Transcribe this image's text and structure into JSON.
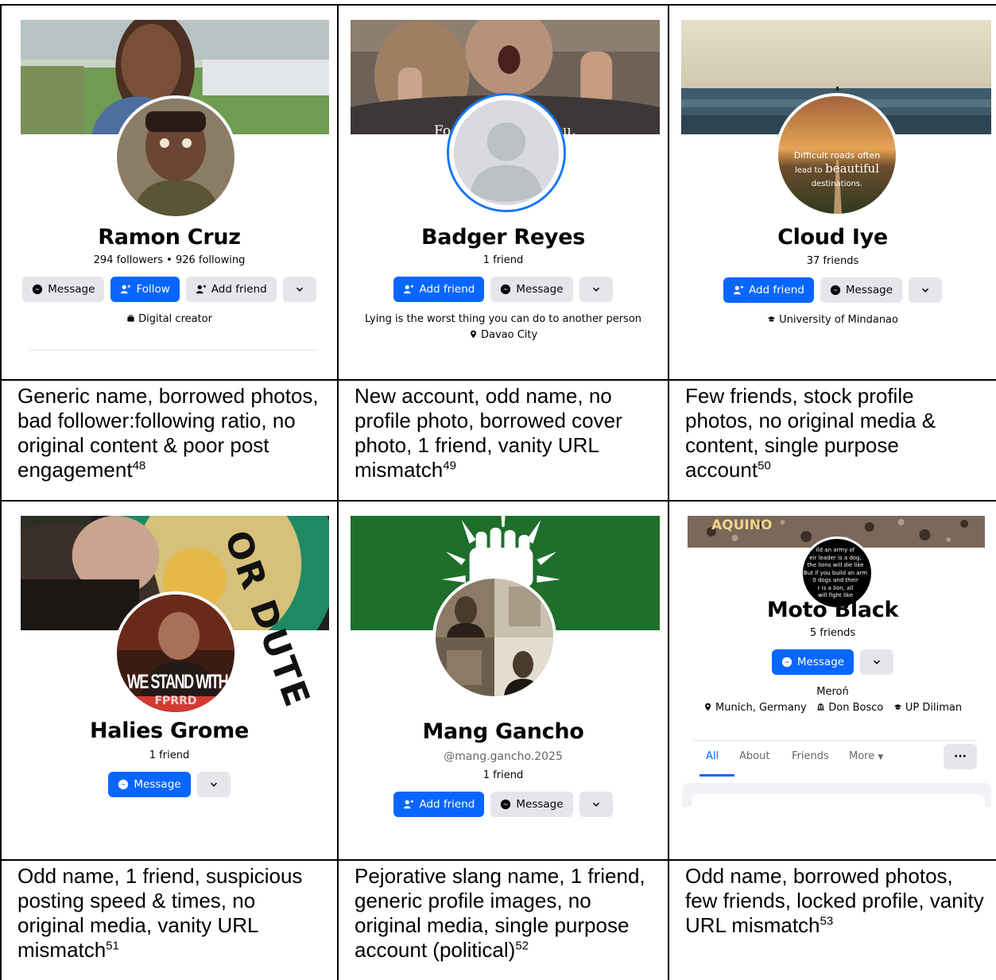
{
  "profiles": [
    {
      "name": "Ramon Cruz",
      "stats": "294 followers • 926 following",
      "buttons": [
        "Message",
        "Follow",
        "Add friend"
      ],
      "info": "Digital creator",
      "caption": "Generic name, borrowed photos, bad follower:following ratio, no original content & poor post engagement",
      "footnote": "48"
    },
    {
      "name": "Badger Reyes",
      "stats": "1 friend",
      "cover_text": "Fo                    u.",
      "buttons": [
        "Add friend",
        "Message"
      ],
      "bio": "Lying is the worst thing you can do to another person",
      "location": "Davao City",
      "caption": "New account, odd name, no profile photo, borrowed cover photo, 1 friend, vanity URL mismatch",
      "footnote": "49"
    },
    {
      "name": "Cloud Iye",
      "stats": "37 friends",
      "avatar_text": [
        "Difficult roads often",
        "lead to",
        "beautiful",
        "destinations."
      ],
      "buttons": [
        "Add friend",
        "Message"
      ],
      "info": "University of Mindanao",
      "caption": "Few friends, stock profile photos, no original media & content, single purpose account",
      "footnote": "50"
    },
    {
      "name": "Halies Grome",
      "stats": "1 friend",
      "cover_text": "OR DUTE",
      "avatar_text": [
        "WE STAND WITH",
        "FPRRD"
      ],
      "buttons": [
        "Message"
      ],
      "caption": "Odd name, 1 friend, suspicious posting speed & times, no original media, vanity URL mismatch",
      "footnote": "51"
    },
    {
      "name": "Mang Gancho",
      "handle": "@mang.gancho.2025",
      "stats": "1 friend",
      "buttons": [
        "Add friend",
        "Message"
      ],
      "caption": "Pejorative slang name, 1 friend, generic profile images, no original media, single purpose account (political)",
      "footnote": "52"
    },
    {
      "name": "Moto Black",
      "stats": "5 friends",
      "cover_text": "AQUINO",
      "avatar_text": [
        "ild an army of",
        "eir leader is a dog,",
        "the lions will die like",
        "But if you build an arm",
        "0 dogs and their",
        "r is a lion, all",
        "will fight like"
      ],
      "buttons": [
        "Message"
      ],
      "bio": "Meroń",
      "details": [
        "Munich, Germany",
        "Don Bosco",
        "UP Diliman"
      ],
      "tabs": [
        "All",
        "About",
        "Friends",
        "More"
      ],
      "caption": "Odd name, borrowed photos, few friends, locked profile, vanity URL mismatch",
      "footnote": "53"
    }
  ],
  "colors": {
    "fb_blue": "#0866ff",
    "button_grey": "#e4e6eb",
    "green_cover": "#1e6f2b"
  },
  "icons": [
    "messenger-icon",
    "add-person-icon",
    "chevron-down-icon",
    "location-pin-icon",
    "graduation-cap-icon",
    "briefcase-icon",
    "school-icon"
  ]
}
